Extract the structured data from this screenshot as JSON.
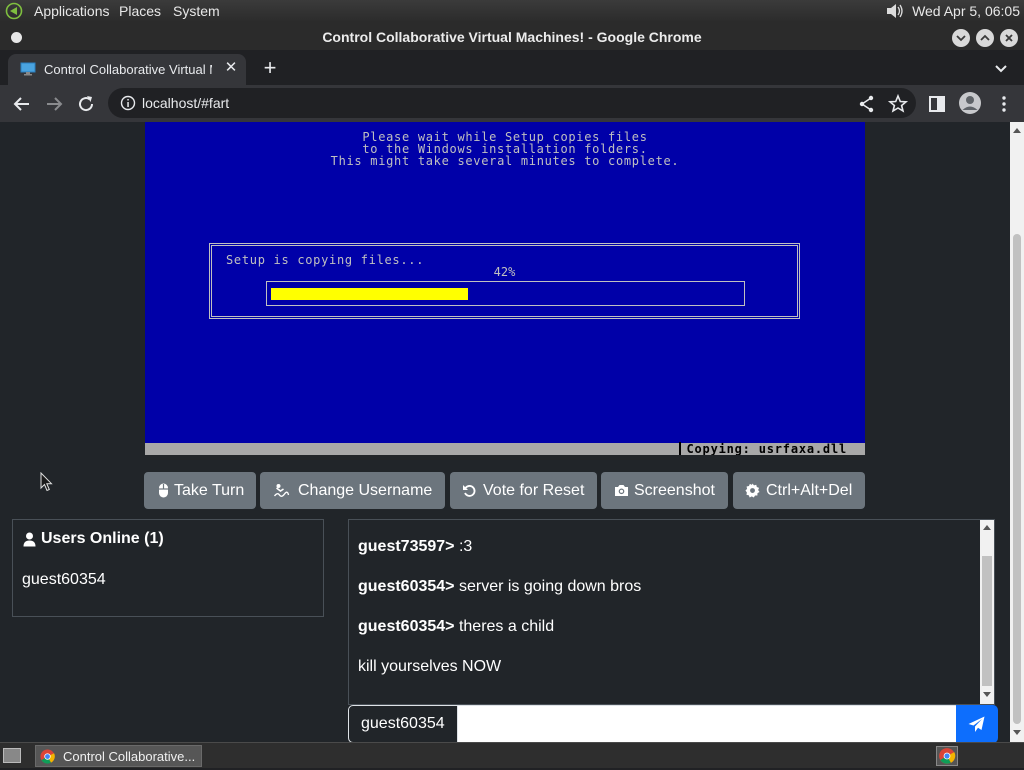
{
  "os_panel": {
    "menus": [
      "Applications",
      "Places",
      "System"
    ],
    "clock": "Wed Apr  5, 06:05"
  },
  "window": {
    "title": "Control Collaborative Virtual Machines! - Google Chrome"
  },
  "tab": {
    "title": "Control Collaborative Virtual M",
    "close": "✕",
    "new_tab": "+"
  },
  "omnibox": {
    "url": "localhost/#fart"
  },
  "vm": {
    "lines": [
      "Please wait while Setup copies files",
      "to the Windows installation folders.",
      "This might take several minutes to complete."
    ],
    "box_title": "Setup is copying files...",
    "percent_text": "42%",
    "progress": 0.42,
    "status": "Copying: usrfaxa.dll",
    "colors": {
      "background": "#0000a8",
      "fill": "#ffff00",
      "text": "#c0c0c0"
    }
  },
  "buttons": {
    "take_turn": "Take Turn",
    "change_username": "Change Username",
    "vote_reset": "Vote for Reset",
    "screenshot": "Screenshot",
    "ctrl_alt_del": "Ctrl+Alt+Del"
  },
  "users": {
    "title": "Users Online (1)",
    "list": [
      "guest60354"
    ]
  },
  "chat": {
    "messages": [
      {
        "user": "guest73597>",
        "text": " :3"
      },
      {
        "user": "guest60354>",
        "text": " server is going down bros"
      },
      {
        "user": "guest60354>",
        "text": " theres a child"
      },
      {
        "user": "",
        "text": "kill yourselves NOW"
      }
    ],
    "username": "guest60354",
    "input_value": ""
  },
  "taskbar": {
    "item": "Control Collaborative..."
  },
  "colors": {
    "page_bg": "#212529",
    "button_bg": "#6c757d",
    "send_bg": "#0d6efd"
  }
}
